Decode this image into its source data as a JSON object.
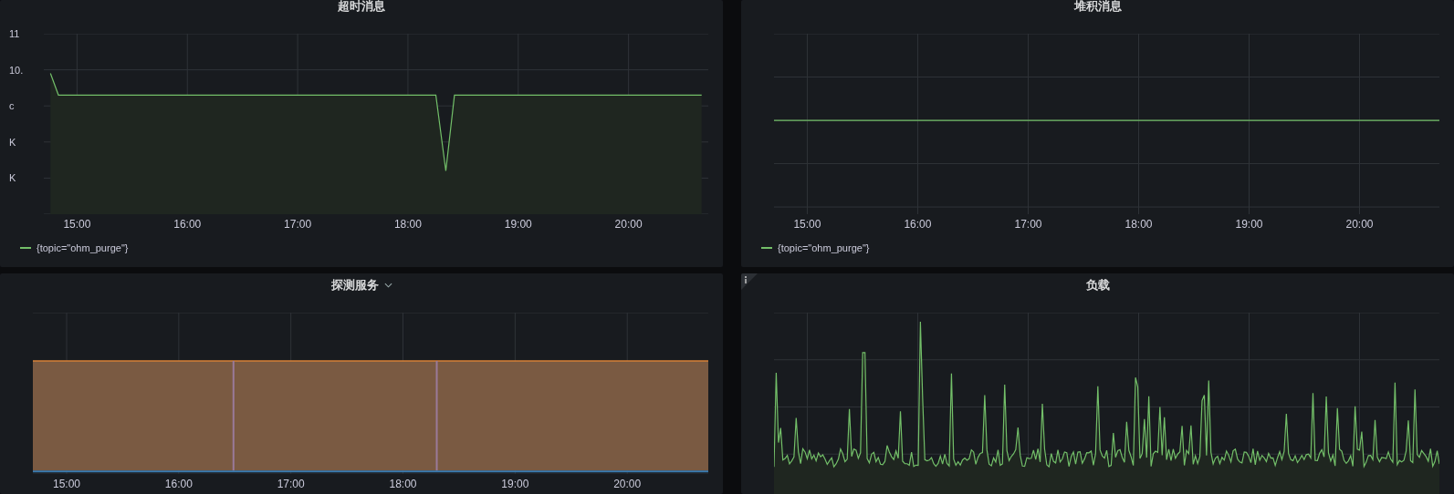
{
  "panels": [
    {
      "title": "超时消息",
      "kind": "dip",
      "y_labels": [
        "11",
        "10.",
        "c",
        "K",
        "K"
      ],
      "x_labels": [
        "15:00",
        "16:00",
        "17:00",
        "18:00",
        "19:00",
        "20:00"
      ],
      "legend": [
        {
          "label": "{topic=\"ohm_purge\"}",
          "color": "#73bf69"
        }
      ]
    },
    {
      "title": "堆积消息",
      "kind": "flat",
      "x_labels": [
        "15:00",
        "16:00",
        "17:00",
        "18:00",
        "19:00",
        "20:00"
      ],
      "legend": [
        {
          "label": "{topic=\"ohm_purge\"}",
          "color": "#73bf69"
        }
      ]
    },
    {
      "title": "探测服务",
      "menu": true,
      "kind": "band",
      "x_labels": [
        "15:00",
        "16:00",
        "17:00",
        "18:00",
        "19:00",
        "20:00"
      ]
    },
    {
      "title": "负载",
      "info": true,
      "kind": "noisy"
    }
  ]
}
